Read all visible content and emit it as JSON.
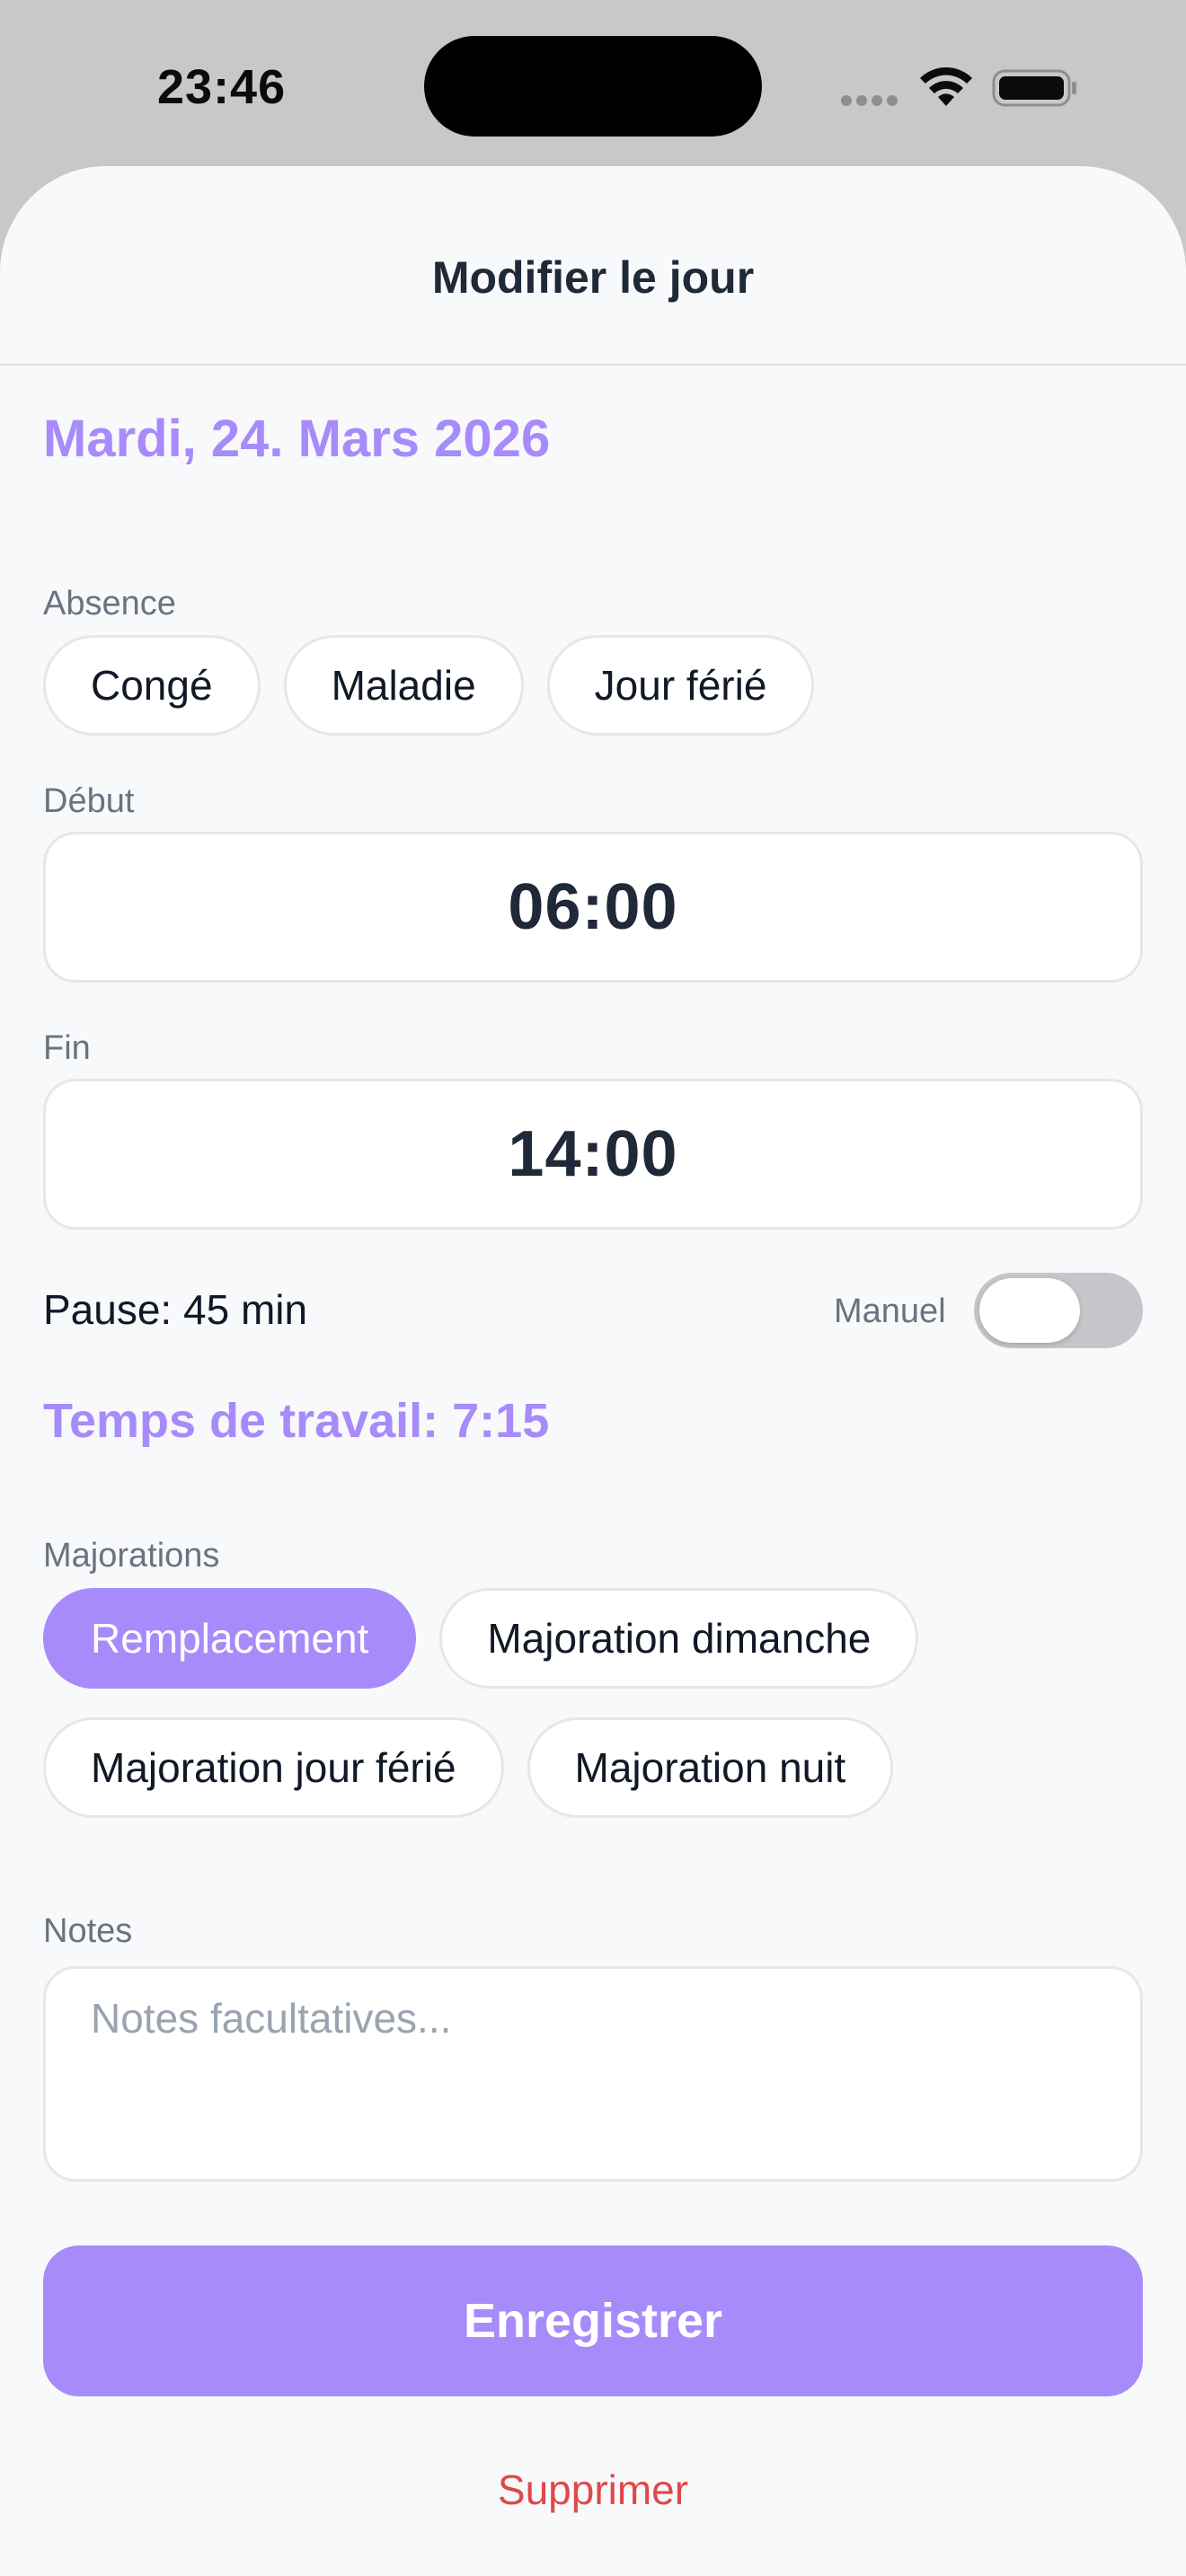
{
  "status_bar": {
    "time": "23:46"
  },
  "sheet": {
    "title": "Modifier le jour"
  },
  "date_heading": "Mardi, 24. Mars 2026",
  "absence": {
    "label": "Absence",
    "options": [
      "Congé",
      "Maladie",
      "Jour férié"
    ]
  },
  "start": {
    "label": "Début",
    "value": "06:00"
  },
  "end": {
    "label": "Fin",
    "value": "14:00"
  },
  "pause": {
    "text": "Pause: 45 min",
    "manual_label": "Manuel",
    "manual_enabled": false
  },
  "worktime_text": "Temps de travail: 7:15",
  "surcharges": {
    "label": "Majorations",
    "options": [
      {
        "label": "Remplacement",
        "selected": true
      },
      {
        "label": "Majoration dimanche",
        "selected": false
      },
      {
        "label": "Majoration jour férié",
        "selected": false
      },
      {
        "label": "Majoration nuit",
        "selected": false
      }
    ]
  },
  "notes": {
    "label": "Notes",
    "placeholder": "Notes facultatives..."
  },
  "save_label": "Enregistrer",
  "delete_label": "Supprimer",
  "colors": {
    "accent": "#a78bfa",
    "danger": "#e0484a",
    "text": "#1f2937",
    "muted": "#6b7280"
  },
  "icons": {
    "wifi": "wifi-icon",
    "battery": "battery-icon",
    "signal": "cellular-signal-icon"
  }
}
